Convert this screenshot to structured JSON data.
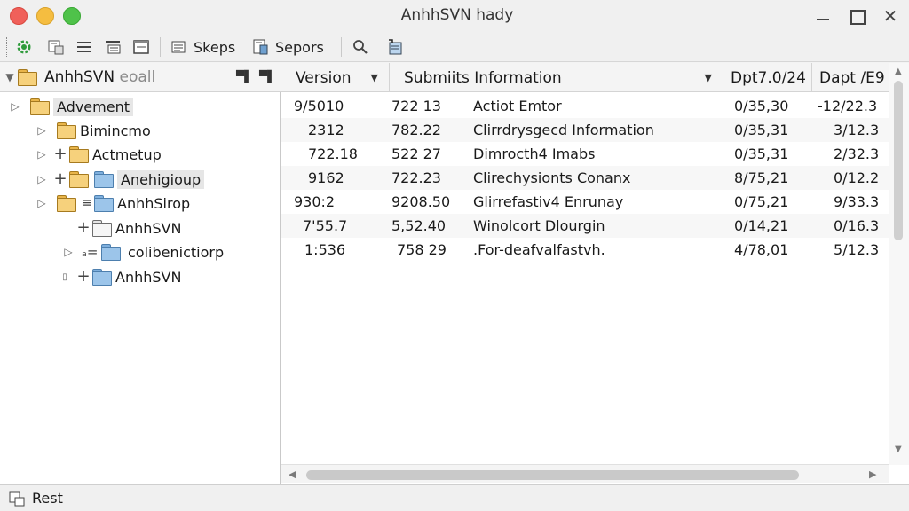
{
  "window": {
    "title": "AnhhSVN hady"
  },
  "toolbar": {
    "skeps_label": "Skeps",
    "sepors_label": "Sepors"
  },
  "tree": {
    "header_label": "AnhhSVN",
    "header_muted": "eoall",
    "nodes": [
      {
        "label": "Advement"
      },
      {
        "label": "Bimincmo"
      },
      {
        "label": "Actmetup"
      },
      {
        "label": "Anehigioup"
      },
      {
        "label": "AnhhSirop"
      },
      {
        "label": "AnhhSVN"
      },
      {
        "label": "colibenictiorp"
      },
      {
        "label": "AnhhSVN"
      }
    ]
  },
  "list": {
    "columns": [
      "Version",
      "Submiits Information",
      "Dpt7.0/24",
      "Dapt /E9"
    ],
    "rows": [
      {
        "version": "9/5010",
        "v2": "722 13",
        "info": "Actiot Emtor",
        "d1": "0/35,30",
        "d2": "-12/22.3"
      },
      {
        "version": "2312",
        "v2": "782.22",
        "info": "Clirrdrysgecd Information",
        "d1": "0/35,31",
        "d2": "3/12.3"
      },
      {
        "version": "722.18",
        "v2": "522 27",
        "info": "Dimrocth4 Imabs",
        "d1": "0/35,31",
        "d2": "2/32.3"
      },
      {
        "version": "9162",
        "v2": "722.23",
        "info": "Clirechysionts Conanx",
        "d1": "8/75,21",
        "d2": "0/12.2"
      },
      {
        "version": "930:2",
        "v2": "9208.50",
        "info": "Glirrefastiv4 Enrunay",
        "d1": "0/75,21",
        "d2": "9/33.3"
      },
      {
        "version": "7'55.7",
        "v2": "5,52.40",
        "info": "Winolcort Dlourgin",
        "d1": "0/14,21",
        "d2": "0/16.3"
      },
      {
        "version": "1:536",
        "v2": "758 29",
        "info": ".For-deafvalfastvh.",
        "d1": "4/78,01",
        "d2": "5/12.3"
      }
    ]
  },
  "status": {
    "label": "Rest"
  }
}
